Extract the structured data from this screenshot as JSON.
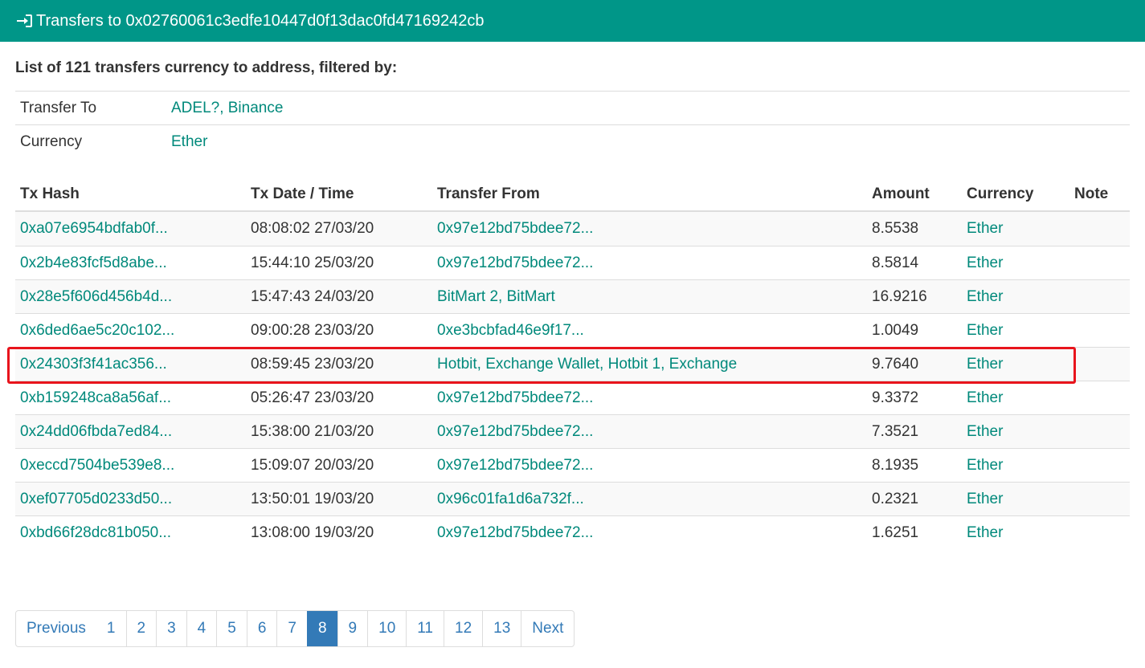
{
  "header": {
    "title": "Transfers to 0x02760061c3edfe10447d0f13dac0fd47169242cb",
    "icon": "sign-in-icon"
  },
  "summary": "List of 121 transfers currency to address, filtered by:",
  "filters": [
    {
      "label": "Transfer To",
      "value": "ADEL?, Binance"
    },
    {
      "label": "Currency",
      "value": "Ether"
    }
  ],
  "table": {
    "headers": {
      "hash": "Tx Hash",
      "date": "Tx Date / Time",
      "from": "Transfer From",
      "amount": "Amount",
      "currency": "Currency",
      "note": "Note"
    },
    "rows": [
      {
        "hash": "0xa07e6954bdfab0f...",
        "date": "08:08:02 27/03/20",
        "from": "0x97e12bd75bdee72...",
        "amount": "8.5538",
        "currency": "Ether"
      },
      {
        "hash": "0x2b4e83fcf5d8abe...",
        "date": "15:44:10 25/03/20",
        "from": "0x97e12bd75bdee72...",
        "amount": "8.5814",
        "currency": "Ether"
      },
      {
        "hash": "0x28e5f606d456b4d...",
        "date": "15:47:43 24/03/20",
        "from": "BitMart 2, BitMart",
        "amount": "16.9216",
        "currency": "Ether"
      },
      {
        "hash": "0x6ded6ae5c20c102...",
        "date": "09:00:28 23/03/20",
        "from": "0xe3bcbfad46e9f17...",
        "amount": "1.0049",
        "currency": "Ether"
      },
      {
        "hash": "0x24303f3f41ac356...",
        "date": "08:59:45 23/03/20",
        "from": "Hotbit, Exchange Wallet, Hotbit 1, Exchange",
        "amount": "9.7640",
        "currency": "Ether"
      },
      {
        "hash": "0xb159248ca8a56af...",
        "date": "05:26:47 23/03/20",
        "from": "0x97e12bd75bdee72...",
        "amount": "9.3372",
        "currency": "Ether"
      },
      {
        "hash": "0x24dd06fbda7ed84...",
        "date": "15:38:00 21/03/20",
        "from": "0x97e12bd75bdee72...",
        "amount": "7.3521",
        "currency": "Ether"
      },
      {
        "hash": "0xeccd7504be539e8...",
        "date": "15:09:07 20/03/20",
        "from": "0x97e12bd75bdee72...",
        "amount": "8.1935",
        "currency": "Ether"
      },
      {
        "hash": "0xef07705d0233d50...",
        "date": "13:50:01 19/03/20",
        "from": "0x96c01fa1d6a732f...",
        "amount": "0.2321",
        "currency": "Ether"
      },
      {
        "hash": "0xbd66f28dc81b050...",
        "date": "13:08:00 19/03/20",
        "from": "0x97e12bd75bdee72...",
        "amount": "1.6251",
        "currency": "Ether"
      }
    ]
  },
  "pagination": {
    "previous": "Previous",
    "next": "Next",
    "pages": [
      "1",
      "2",
      "3",
      "4",
      "5",
      "6",
      "7",
      "8",
      "9",
      "10",
      "11",
      "12",
      "13"
    ],
    "active": "8"
  },
  "colors": {
    "header_bg": "#009688",
    "link": "#00897b",
    "highlight_border": "#e8141c",
    "pager_active": "#337ab7"
  }
}
